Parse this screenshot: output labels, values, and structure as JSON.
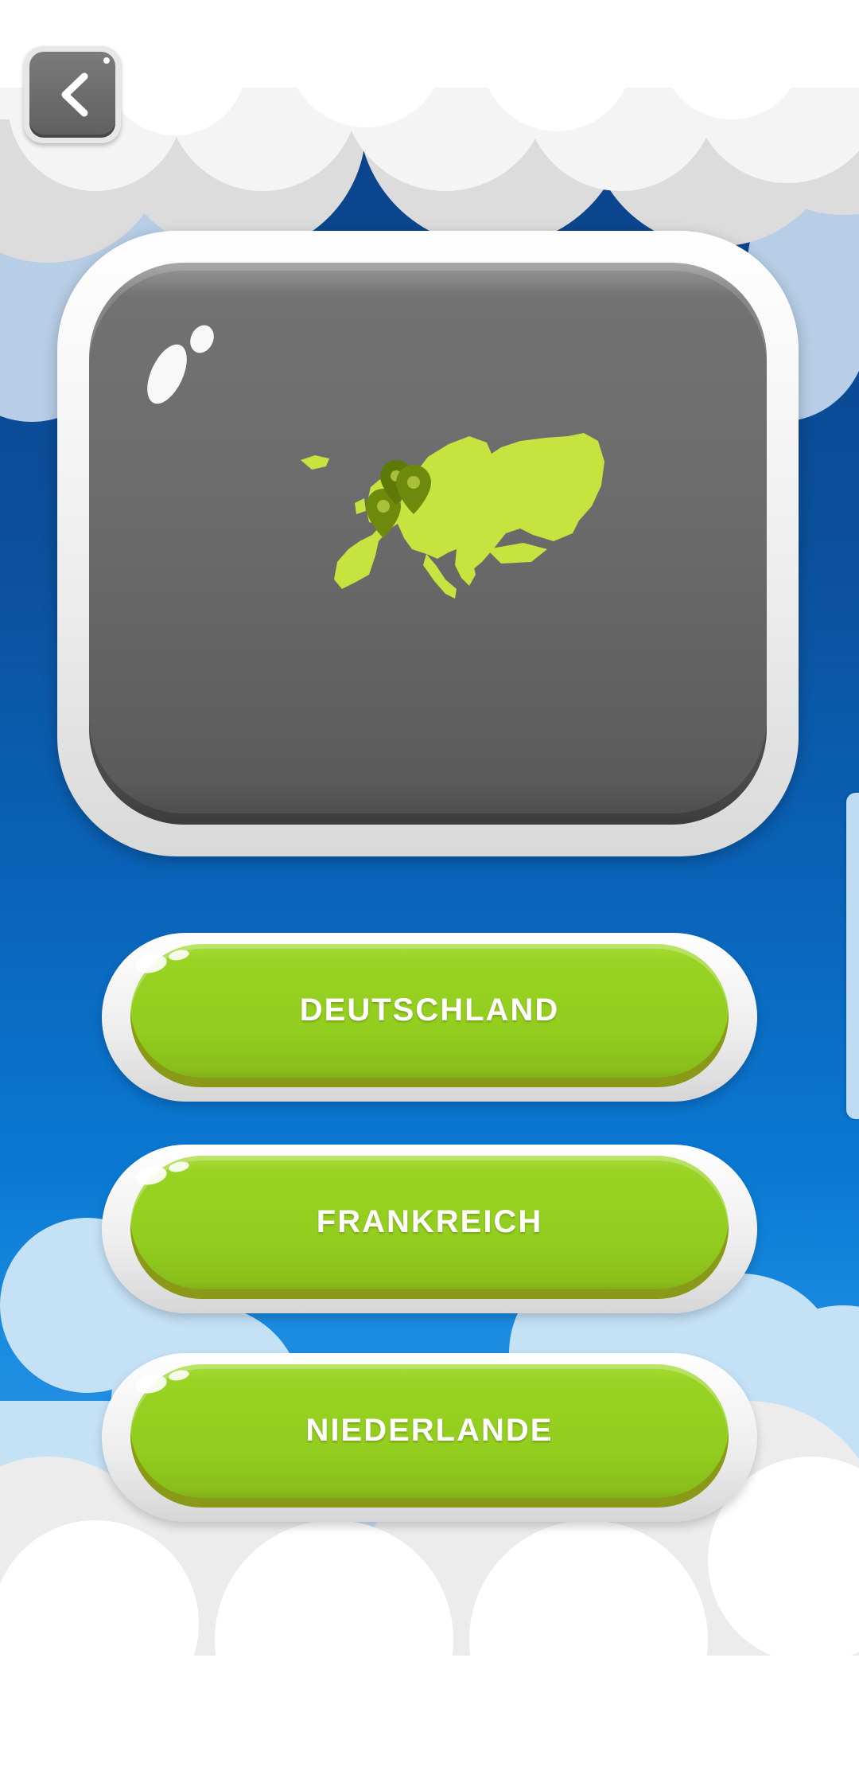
{
  "screen": {
    "back_icon": "chevron-left-icon",
    "question_image": "europe-map-with-location-pins",
    "colors": {
      "sky_top": "#0a3f86",
      "sky_bottom": "#3ca2ea",
      "answer_green": "#93cd1f",
      "map_land": "#c6e33f",
      "map_pin": "#6e8a0c",
      "screen_gray": "#6a6a6a"
    }
  },
  "answers": [
    {
      "label": "DEUTSCHLAND"
    },
    {
      "label": "FRANKREICH"
    },
    {
      "label": "NIEDERLANDE"
    }
  ]
}
